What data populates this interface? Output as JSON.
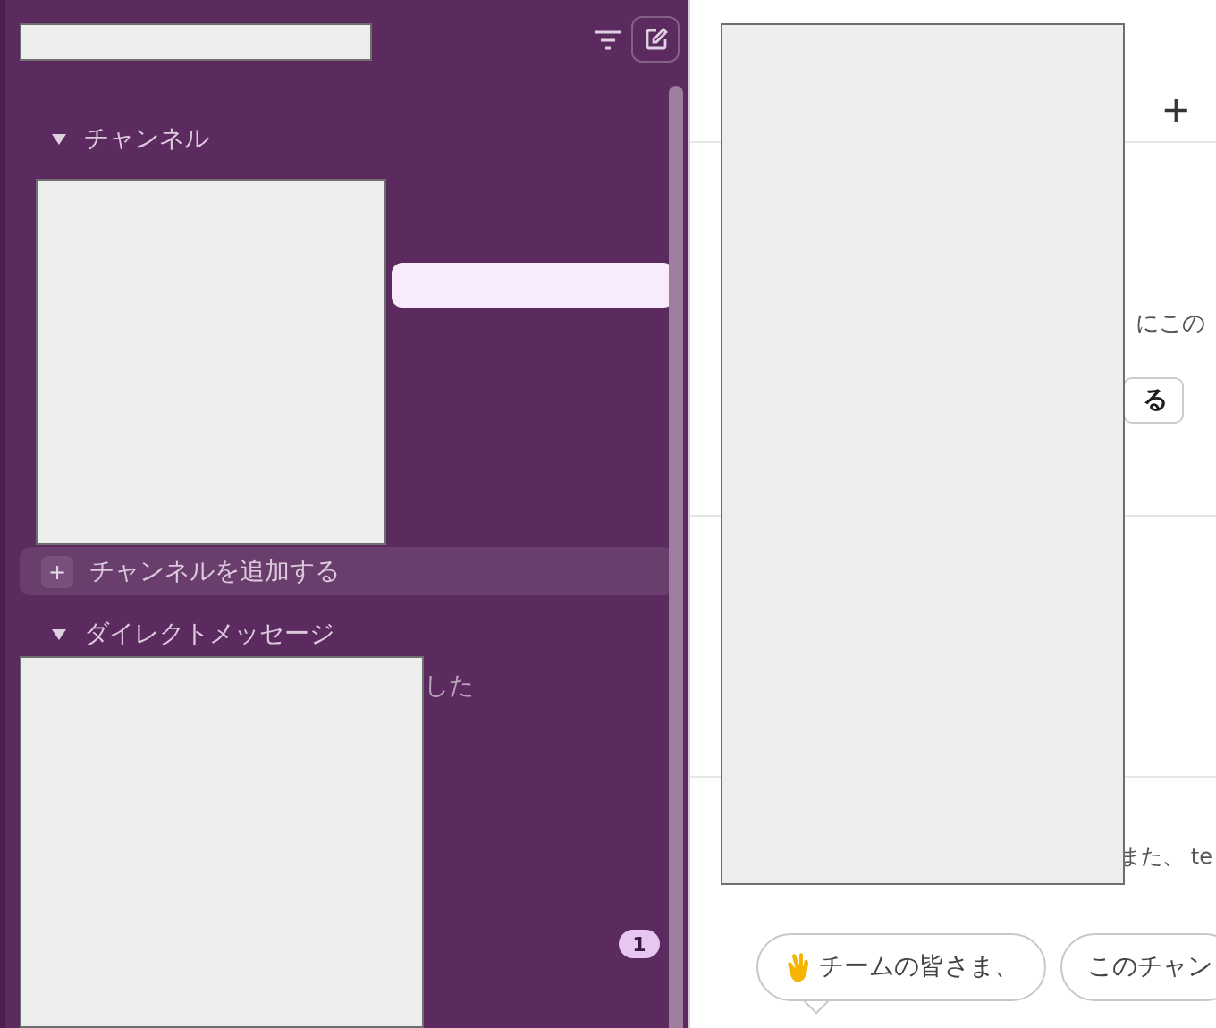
{
  "sidebar": {
    "sections": [
      {
        "kind": "channels",
        "title": "チャンネル",
        "expanded": true,
        "add_icon": "+",
        "add_label": "チャンネルを追加する"
      },
      {
        "kind": "direct",
        "title": "ダイレクトメッセージ",
        "expanded": true,
        "preview": "した",
        "badge": "1"
      }
    ]
  },
  "main": {
    "header_add": "+",
    "intro_text": "にこの",
    "intro_button": "る",
    "message_text": "また、 te",
    "suggestions": [
      {
        "kind": "wave",
        "text": "チームの皆さま、"
      },
      {
        "kind": "plain",
        "text": "このチャン"
      }
    ]
  }
}
